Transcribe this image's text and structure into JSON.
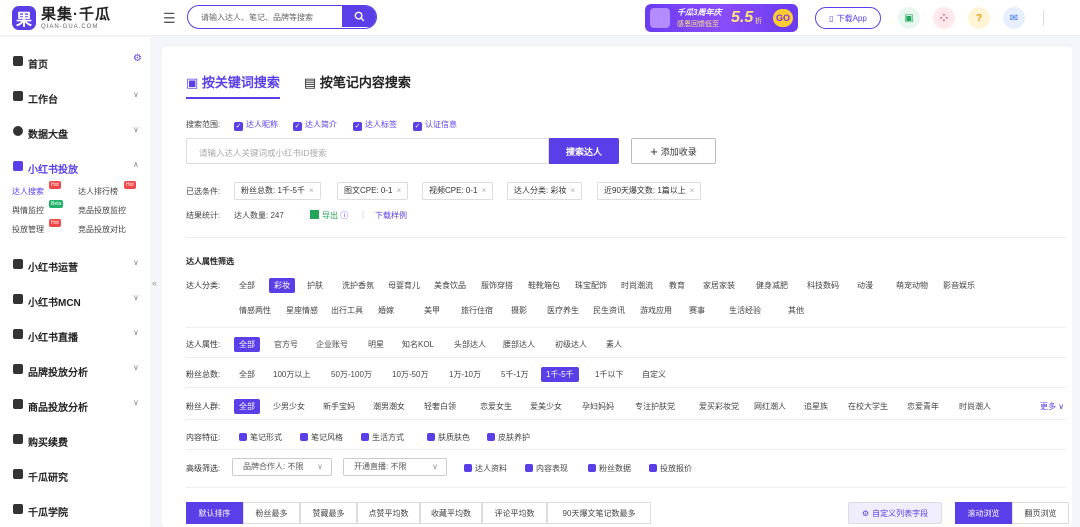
{
  "header": {
    "logo_cn": "果集·千瓜",
    "logo_en": "QIAN-GUA.COM",
    "search_placeholder": "请输入达人、笔记、品牌等搜索",
    "banner": {
      "line1": "千瓜3周年庆",
      "line2": "感恩回馈低至",
      "discount": "5.5",
      "unit": "折",
      "go": "GO"
    },
    "download_label": "下载App"
  },
  "sidebar": {
    "items": [
      {
        "label": "首页"
      },
      {
        "label": "工作台"
      },
      {
        "label": "数据大盘"
      },
      {
        "label": "小红书投放"
      },
      {
        "label": "小红书运营"
      },
      {
        "label": "小红书MCN"
      },
      {
        "label": "小红书直播"
      },
      {
        "label": "品牌投放分析"
      },
      {
        "label": "商品投放分析"
      },
      {
        "label": "购买续费"
      },
      {
        "label": "千瓜研究"
      },
      {
        "label": "千瓜学院"
      }
    ],
    "sub": [
      {
        "label": "达人搜索",
        "badge": "Hot"
      },
      {
        "label": "达人排行榜",
        "badge": "Hot"
      },
      {
        "label": "舆情监控",
        "badge": "Beta"
      },
      {
        "label": "竞品投放监控"
      },
      {
        "label": "投放管理",
        "badge": "Hot"
      },
      {
        "label": "竞品投放对比"
      }
    ]
  },
  "main": {
    "tabs": [
      "按关键词搜索",
      "按笔记内容搜索"
    ],
    "scope_label": "搜索范围:",
    "scope": [
      "达人昵称",
      "达人简介",
      "达人标签",
      "认证信息"
    ],
    "keyword_placeholder": "请输入达人关键词或小红书ID搜索",
    "search_btn": "搜索达人",
    "add_btn": "添加收录",
    "selected_label": "已选条件:",
    "chips": [
      "粉丝总数: 1千-5千",
      "图文CPE: 0-1",
      "视频CPE: 0-1",
      "达人分类: 彩妆",
      "近90天爆文数: 1篇以上"
    ],
    "result_label": "结果统计:",
    "result_count": "达人数量: 247",
    "export": "导出",
    "download_sample": "下载样例",
    "attr_section": "达人属性筛选",
    "category_label": "达人分类:",
    "categories_row1": [
      "全部",
      "彩妆",
      "护肤",
      "洗护香氛",
      "母婴育儿",
      "美食饮品",
      "服饰穿搭",
      "鞋靴箱包",
      "珠宝配饰",
      "时尚潮流",
      "教育",
      "家居家装",
      "健身减肥",
      "科技数码",
      "动漫",
      "萌宠动物",
      "影音娱乐"
    ],
    "categories_row2": [
      "情感两性",
      "星座情感",
      "出行工具",
      "婚嫁",
      "美甲",
      "旅行住宿",
      "摄影",
      "医疗养生",
      "民生资讯",
      "游戏应用",
      "赛事",
      "生活经验",
      "其他"
    ],
    "attr_label": "达人属性:",
    "attrs": [
      "全部",
      "官方号",
      "企业账号",
      "明星",
      "知名KOL",
      "头部达人",
      "腰部达人",
      "初级达人",
      "素人"
    ],
    "fans_label": "粉丝总数:",
    "fans": [
      "全部",
      "100万以上",
      "50万-100万",
      "10万-50万",
      "1万-10万",
      "5千-1万",
      "1千-5千",
      "1千以下",
      "自定义"
    ],
    "crowd_label": "粉丝人群:",
    "crowd": [
      "全部",
      "少男少女",
      "新手宝妈",
      "潮男潮女",
      "轻奢白领",
      "恋爱女生",
      "爱美少女",
      "孕妇妈妈",
      "专注护肤党",
      "爱买彩妆党",
      "网红潮人",
      "追星族",
      "在校大学生",
      "恋爱青年",
      "时尚潮人"
    ],
    "more": "更多",
    "content_label": "内容特征:",
    "content": [
      "笔记形式",
      "笔记风格",
      "生活方式",
      "肤质肤色",
      "皮肤养护"
    ],
    "adv_label": "高级筛选:",
    "adv_dd1": "品牌合作人: 不限",
    "adv_dd2": "开通直播: 不限",
    "adv_links": [
      "达人资料",
      "内容表现",
      "粉丝数据",
      "投放报价"
    ],
    "sorts": [
      "默认排序",
      "粉丝最多",
      "赞藏最多",
      "点赞平均数",
      "收藏平均数",
      "评论平均数",
      "90天爆文笔记数最多"
    ],
    "custom_cols": "自定义列表字段",
    "view_scroll": "滚动浏览",
    "view_page": "翻页浏览"
  }
}
